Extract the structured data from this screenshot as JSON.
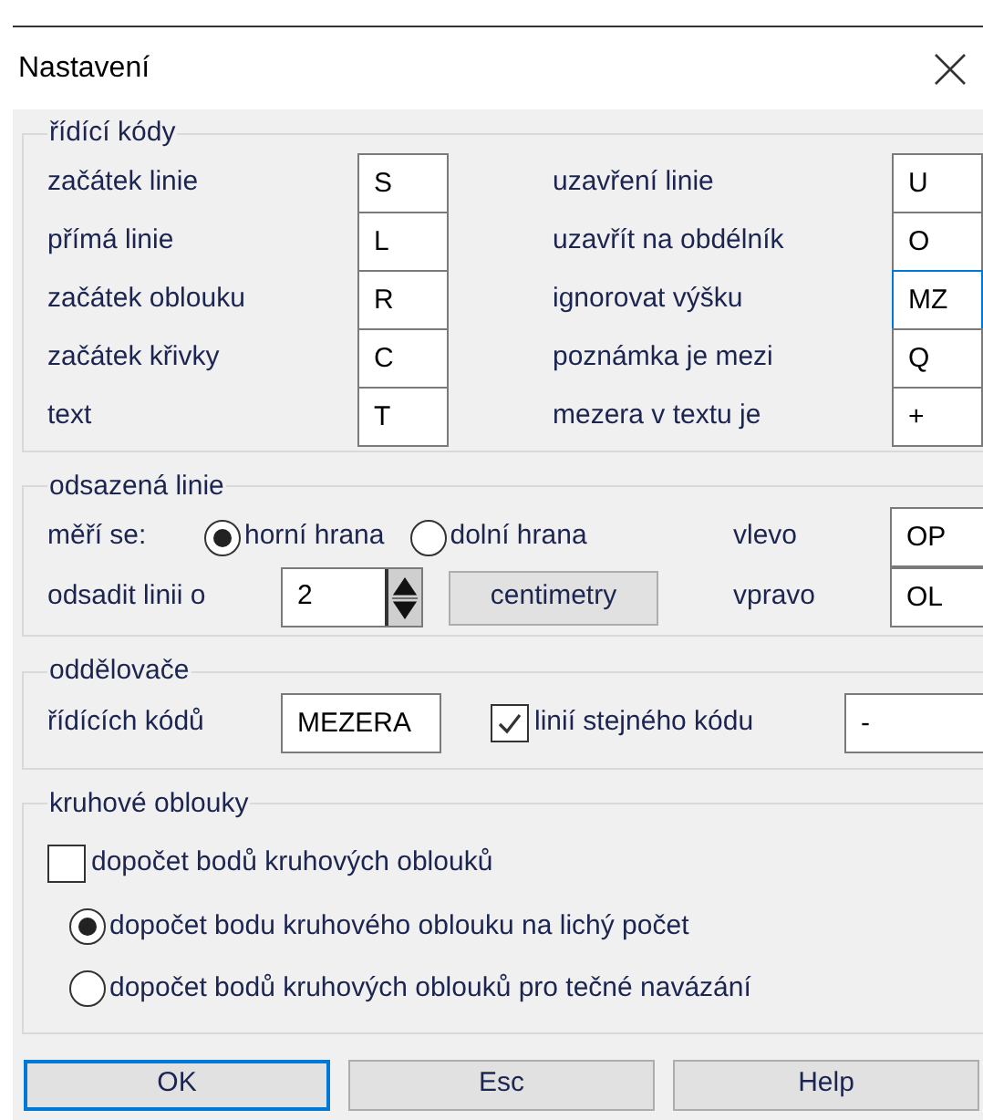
{
  "window": {
    "title": "Nastavení"
  },
  "control_codes": {
    "title": "řídící kódy",
    "fields": [
      {
        "label": "začátek linie",
        "value": "S",
        "focused": false
      },
      {
        "label": "uzavření linie",
        "value": "U",
        "focused": false
      },
      {
        "label": "přímá linie",
        "value": "L",
        "focused": false
      },
      {
        "label": "uzavřít na obdélník",
        "value": "O",
        "focused": false
      },
      {
        "label": "začátek oblouku",
        "value": "R",
        "focused": false
      },
      {
        "label": "ignorovat výšku",
        "value": "MZ",
        "focused": true
      },
      {
        "label": "začátek křivky",
        "value": "C",
        "focused": false
      },
      {
        "label": "poznámka je mezi",
        "value": "Q",
        "focused": false
      },
      {
        "label": "text",
        "value": "T",
        "focused": false
      },
      {
        "label": "mezera v textu je",
        "value": "+",
        "focused": false
      }
    ]
  },
  "offset_line": {
    "title": "odsazená linie",
    "measure_label": "měří se:",
    "radios": [
      {
        "label": "horní hrana",
        "selected": true
      },
      {
        "label": "dolní hrana",
        "selected": false
      }
    ],
    "left_label": "vlevo",
    "left_value": "OP",
    "offset_label": "odsadit linii o",
    "offset_value": "2",
    "unit_button": "centimetry",
    "right_label": "vpravo",
    "right_value": "OL"
  },
  "separators": {
    "title": "oddělovače",
    "codes_label": "řídících kódů",
    "codes_value": "MEZERA",
    "same_code": {
      "label": "linií stejného kódu",
      "checked": true
    },
    "same_code_value": "-"
  },
  "circular_arcs": {
    "title": "kruhové oblouky",
    "checkbox": {
      "label": "dopočet bodů kruhových oblouků",
      "checked": false
    },
    "radios": [
      {
        "label": "dopočet bodu kruhového oblouku na lichý počet",
        "selected": true
      },
      {
        "label": "dopočet bodů kruhových oblouků pro tečné navázání",
        "selected": false
      }
    ]
  },
  "buttons": [
    {
      "label": "OK",
      "default": true
    },
    {
      "label": "Esc",
      "default": false
    },
    {
      "label": "Help",
      "default": false
    }
  ]
}
